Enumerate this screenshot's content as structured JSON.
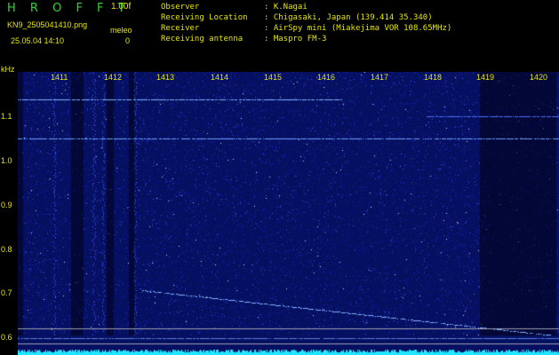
{
  "header": {
    "app_title": "H R O F F T",
    "version": "1.00f",
    "filename": "KN9_2505041410.png",
    "meleo_label": "meleo",
    "timestamp": "25.05.04 14:10",
    "meleo_value": "0"
  },
  "info": [
    {
      "key": "Observer",
      "value": ": K.Nagai"
    },
    {
      "key": "Receiving Location",
      "value": ": Chigasaki, Japan (139.414 35.340)"
    },
    {
      "key": "Receiver",
      "value": ": AirSpy mini (Miakejima VOR 108.65MHz)"
    },
    {
      "key": "Receiving antenna",
      "value": ": Maspro FM-3"
    }
  ],
  "spectrogram": {
    "frequency_unit": "kHz",
    "freq_labels": [
      "1.1",
      "1.0",
      "0.9",
      "0.8",
      "0.7",
      "0.6"
    ],
    "time_labels": [
      "1411",
      "1412",
      "1413",
      "1414",
      "1415",
      "1416",
      "1417",
      "1418",
      "1419",
      "1420"
    ],
    "colors": {
      "background": "#0a0f7a",
      "trace": "#20e6ff",
      "label": "#e6e600",
      "title": "#35d335"
    }
  }
}
